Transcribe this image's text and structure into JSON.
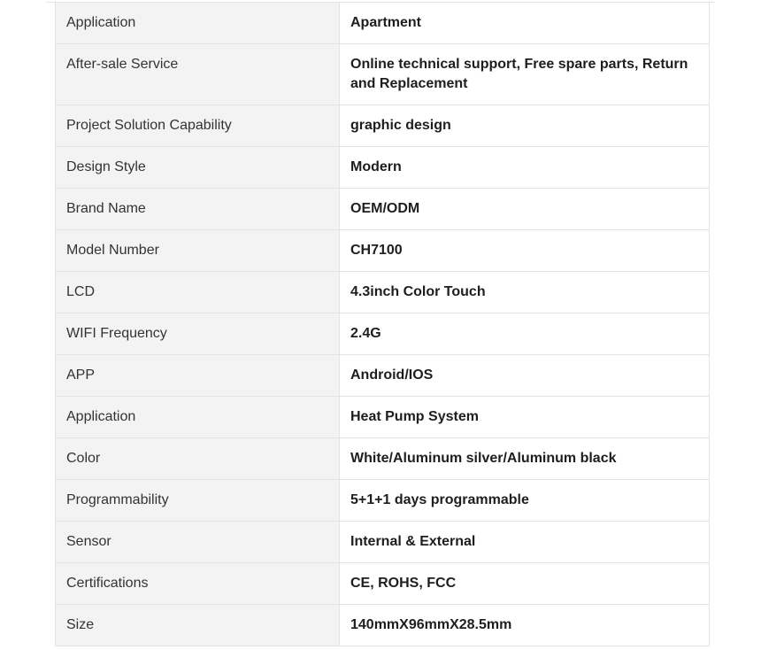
{
  "specs": {
    "rows": [
      {
        "key": "Application",
        "value": "Apartment"
      },
      {
        "key": "After-sale Service",
        "value": "Online technical support, Free spare parts, Return and Replacement"
      },
      {
        "key": "Project Solution Capability",
        "value": "graphic design"
      },
      {
        "key": "Design Style",
        "value": "Modern"
      },
      {
        "key": "Brand Name",
        "value": "OEM/ODM"
      },
      {
        "key": "Model Number",
        "value": "CH7100"
      },
      {
        "key": "LCD",
        "value": "4.3inch Color Touch"
      },
      {
        "key": "WIFI Frequency",
        "value": "2.4G"
      },
      {
        "key": "APP",
        "value": "Android/IOS"
      },
      {
        "key": "Application",
        "value": "Heat Pump System"
      },
      {
        "key": "Color",
        "value": "White/Aluminum silver/Aluminum black"
      },
      {
        "key": "Programmability",
        "value": "5+1+1 days programmable"
      },
      {
        "key": "Sensor",
        "value": "Internal & External"
      },
      {
        "key": "Certifications",
        "value": "CE, ROHS, FCC"
      },
      {
        "key": "Size",
        "value": "140mmX96mmX28.5mm"
      }
    ]
  }
}
